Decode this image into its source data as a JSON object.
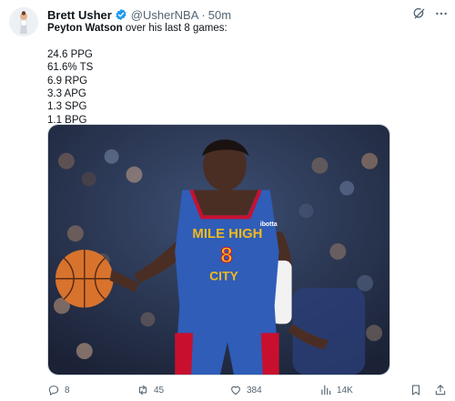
{
  "author": {
    "name": "Brett Usher",
    "handle": "@UsherNBA",
    "separator": "·",
    "time": "50m",
    "verified_color": "#1d9bf0"
  },
  "icons": {
    "avatar": "avatar-image",
    "verified": "verified-badge-icon",
    "grok": "grok-icon",
    "more": "more-icon"
  },
  "tweet": {
    "subject": "Peyton Watson",
    "intro_rest": " over his last 8 games:",
    "stats": [
      "24.6 PPG",
      "61.6% TS",
      "6.9 RPG",
      "3.3 APG",
      "1.3 SPG",
      "1.1 BPG"
    ]
  },
  "media": {
    "jersey_text_line1": "MILE HIGH",
    "jersey_number": "8",
    "jersey_text_line2": "CITY",
    "sponsor": "ibotta",
    "jersey_color": "#2f5db8",
    "jersey_accent": "#f2b91d"
  },
  "actions": {
    "replies": "8",
    "reposts": "45",
    "likes": "384",
    "views": "14K"
  }
}
